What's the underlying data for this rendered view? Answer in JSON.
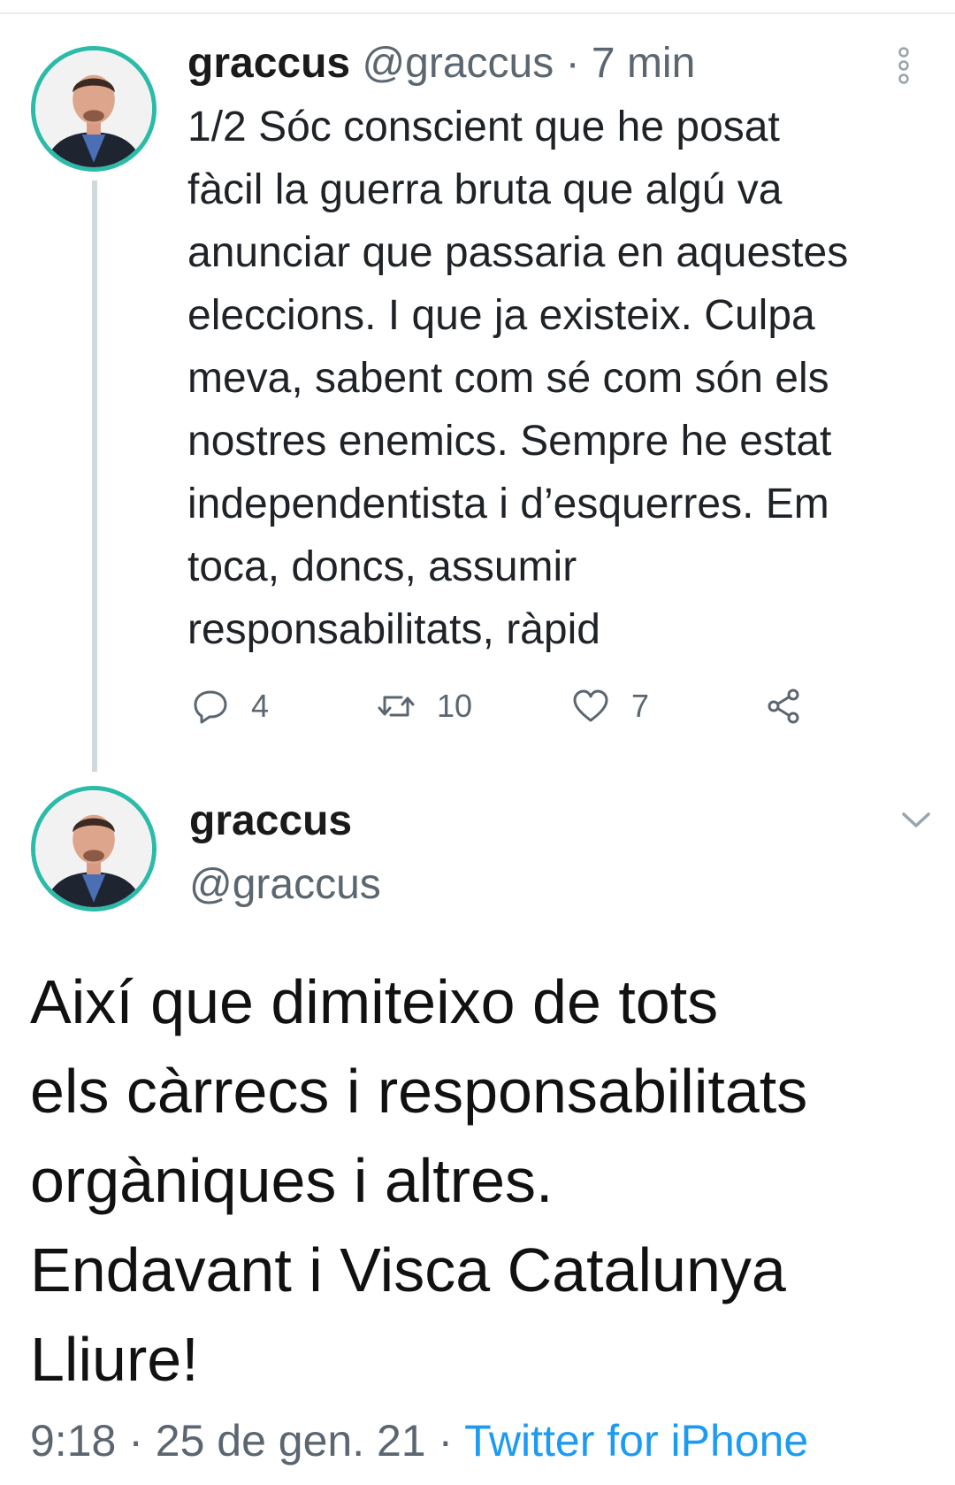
{
  "tweet1": {
    "display_name": "graccus",
    "handle": "@graccus",
    "separator": " · ",
    "time": "7 min",
    "text": "1/2 Sóc conscient que he posat\nfàcil la guerra bruta que algú va\nanunciar que passaria en aquestes\neleccions. I que ja existeix. Culpa\nmeva, sabent com sé com són els\nnostres enemics.  Sempre he estat\nindependentista i d’esquerres. Em\ntoca, doncs, assumir\nresponsabilitats, ràpid",
    "replies": "4",
    "retweets": "10",
    "likes": "7",
    "icons": {
      "more": "more-vertical-icon",
      "reply": "reply-icon",
      "retweet": "retweet-icon",
      "like": "heart-icon",
      "share": "share-icon"
    }
  },
  "tweet2": {
    "display_name": "graccus",
    "handle": "@graccus",
    "text": "Així que dimiteixo de tots\nels càrrecs i responsabilitats\norgàniques i altres.\nEndavant i Visca Catalunya\nLliure!",
    "time": "9:18",
    "separator": " · ",
    "date": "25 de gen. 21",
    "separator2": " · ",
    "source": "Twitter for iPhone",
    "icons": {
      "menu": "chevron-down-icon"
    }
  },
  "colors": {
    "avatar_ring": "#2bbba8",
    "thread_line": "#cfd9de",
    "muted_text": "#5b6670",
    "link": "#1d9bf0"
  }
}
